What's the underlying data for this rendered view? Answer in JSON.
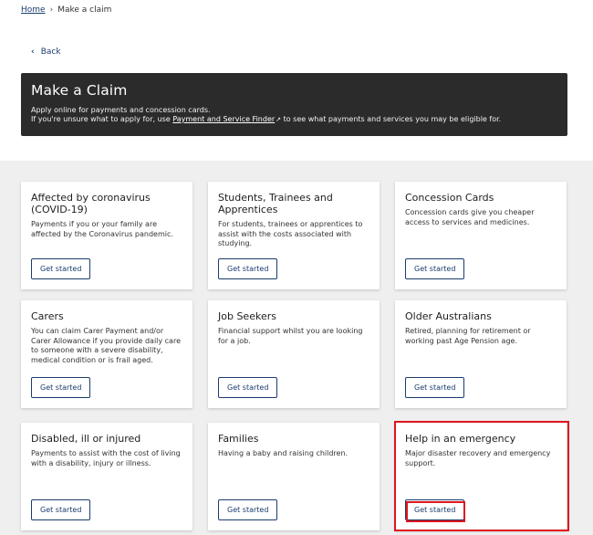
{
  "breadcrumb": {
    "home": "Home",
    "separator": "›",
    "current": "Make a claim"
  },
  "back": {
    "icon": "chevron-left-icon",
    "label": "Back"
  },
  "banner": {
    "title": "Make a Claim",
    "line1": "Apply online for payments and concession cards.",
    "line2_prefix": "If you're unsure what to apply for, use ",
    "line2_link": "Payment and Service Finder",
    "line2_link_icon": "external-link-icon",
    "line2_suffix": " to see what payments and services you may be eligible for."
  },
  "cards": [
    {
      "title": "Affected by coronavirus (COVID-19)",
      "desc": "Payments if you or your family are affected by the Coronavirus pandemic.",
      "button": "Get started"
    },
    {
      "title": "Students, Trainees and Apprentices",
      "desc": "For students, trainees or apprentices to assist with the costs associated with studying.",
      "button": "Get started"
    },
    {
      "title": "Concession Cards",
      "desc": "Concession cards give you cheaper access to services and medicines.",
      "button": "Get started"
    },
    {
      "title": "Carers",
      "desc": "You can claim Carer Payment and/or Carer Allowance if you provide daily care to someone with a severe disability, medical condition or is frail aged.",
      "button": "Get started"
    },
    {
      "title": "Job Seekers",
      "desc": "Financial support whilst you are looking for a job.",
      "button": "Get started"
    },
    {
      "title": "Older Australians",
      "desc": "Retired, planning for retirement or working past Age Pension age.",
      "button": "Get started"
    },
    {
      "title": "Disabled, ill or injured",
      "desc": "Payments to assist with the cost of living with a disability, injury or illness.",
      "button": "Get started"
    },
    {
      "title": "Families",
      "desc": "Having a baby and raising children.",
      "button": "Get started"
    },
    {
      "title": "Help in an emergency",
      "desc": "Major disaster recovery and emergency support.",
      "button": "Get started"
    }
  ],
  "colors": {
    "accent": "#1a3c6e",
    "highlight": "#e0141e",
    "banner": "#2b2b2b"
  }
}
